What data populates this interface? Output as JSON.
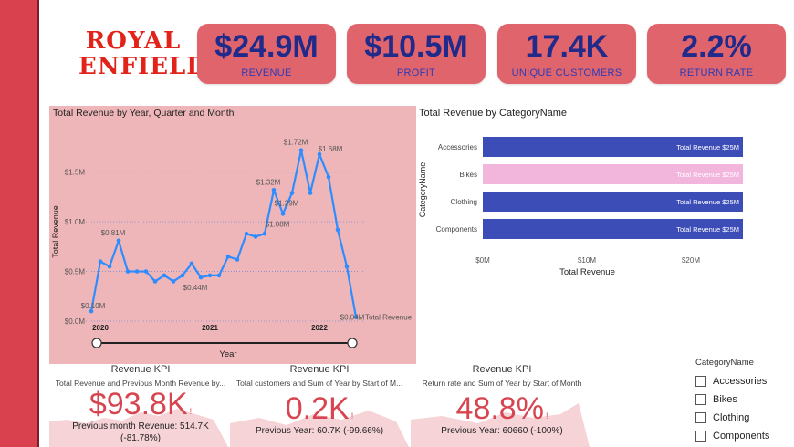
{
  "brand": {
    "line1": "ROYAL",
    "line2": "ENFIELD"
  },
  "cards": [
    {
      "value": "$24.9M",
      "label": "REVENUE"
    },
    {
      "value": "$10.5M",
      "label": "PROFIT"
    },
    {
      "value": "17.4K",
      "label": "UNIQUE CUSTOMERS"
    },
    {
      "value": "2.2%",
      "label": "RETURN RATE"
    }
  ],
  "line_panel": {
    "title": "Total Revenue by Year, Quarter and Month",
    "series_label": "Total Revenue"
  },
  "bar_panel": {
    "title": "Total Revenue by CategoryName"
  },
  "chart_data": [
    {
      "type": "line",
      "title": "Total Revenue by Year, Quarter and Month",
      "xlabel": "Year",
      "ylabel": "Total Revenue",
      "ylim": [
        0,
        1.8
      ],
      "y_ticks": [
        "$0.0M",
        "$0.5M",
        "$1.0M",
        "$1.5M"
      ],
      "y_tick_values": [
        0,
        0.5,
        1.0,
        1.5
      ],
      "x_ticks": [
        "2020",
        "2021",
        "2022"
      ],
      "x_tick_index": [
        1,
        13,
        25
      ],
      "grid": true,
      "series": [
        {
          "name": "Total Revenue",
          "values": [
            0.1,
            0.6,
            0.55,
            0.81,
            0.5,
            0.5,
            0.5,
            0.4,
            0.46,
            0.4,
            0.46,
            0.58,
            0.44,
            0.46,
            0.46,
            0.65,
            0.62,
            0.88,
            0.85,
            0.88,
            1.32,
            1.08,
            1.29,
            1.72,
            1.29,
            1.68,
            1.45,
            0.92,
            0.55,
            0.04
          ]
        }
      ],
      "data_labels": [
        {
          "index": 0,
          "text": "$0.10M"
        },
        {
          "index": 3,
          "text": "$0.81M"
        },
        {
          "index": 12,
          "text": "$0.44M"
        },
        {
          "index": 20,
          "text": "$1.32M"
        },
        {
          "index": 21,
          "text": "$1.08M"
        },
        {
          "index": 22,
          "text": "$1.29M"
        },
        {
          "index": 23,
          "text": "$1.72M"
        },
        {
          "index": 25,
          "text": "$1.68M"
        },
        {
          "index": 29,
          "text": "$0.04M"
        }
      ]
    },
    {
      "type": "bar",
      "orientation": "horizontal",
      "title": "Total Revenue by CategoryName",
      "xlabel": "Total Revenue",
      "ylabel": "CategoryName",
      "xlim": [
        0,
        25
      ],
      "x_ticks": [
        "$0M",
        "$10M",
        "$20M"
      ],
      "x_tick_values": [
        0,
        10,
        20
      ],
      "categories": [
        "Accessories",
        "Bikes",
        "Clothing",
        "Components"
      ],
      "values": [
        25,
        25,
        25,
        25
      ],
      "value_labels": [
        "Total Revenue $25M",
        "Total Revenue $25M",
        "Total Revenue $25M",
        "Total Revenue $25M"
      ],
      "colors": [
        "#3d4db7",
        "#f2b5dc",
        "#3d4db7",
        "#3d4db7"
      ]
    }
  ],
  "kpis": [
    {
      "title": "Revenue KPI",
      "subtitle": "Total Revenue and Previous Month Revenue by...",
      "value": "$93.8K",
      "prev_line1": "Previous month Revenue: 514.7K",
      "prev_line2": "(-81.78%)"
    },
    {
      "title": "Revenue KPI",
      "subtitle": "Total customers and Sum of Year by Start of M...",
      "value": "0.2K",
      "prev_line1": "Previous Year: 60.7K (-99.66%)",
      "prev_line2": ""
    },
    {
      "title": "Revenue KPI",
      "subtitle": "Return rate and Sum of Year by Start of Month",
      "value": "48.8%",
      "prev_line1": "Previous Year: 60660 (-100%)",
      "prev_line2": ""
    }
  ],
  "kpi_alert": "!",
  "slicer": {
    "title": "CategoryName",
    "items": [
      "Accessories",
      "Bikes",
      "Clothing",
      "Components"
    ]
  },
  "colors": {
    "accent": "#d9414f",
    "card_bg": "#e0646c",
    "card_value": "#1f2a8a",
    "line": "#2f8cff",
    "panel_bg": "#eeb6b9",
    "bar_blue": "#3d4db7",
    "bar_pink": "#f2b5dc",
    "kpi_value": "#d64550"
  }
}
